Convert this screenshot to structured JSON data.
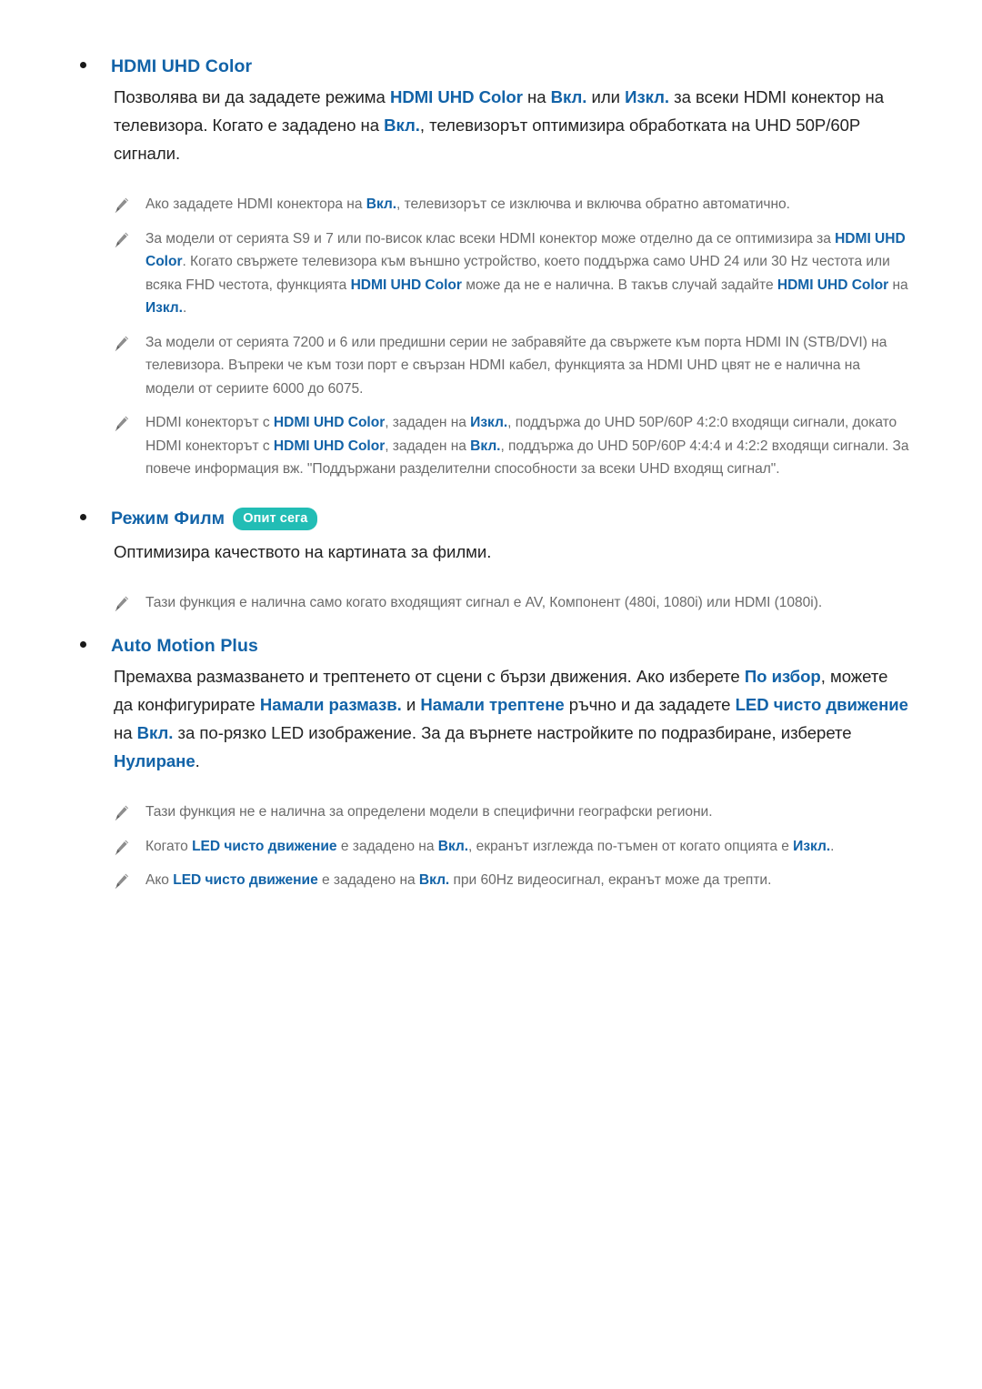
{
  "document": {
    "language": "bg",
    "colors": {
      "link_blue": "#1263a8",
      "body_text": "#232323",
      "note_text": "#6b6b6b",
      "badge_teal": "#22bdb5",
      "bullet": "#1a1a1a",
      "background": "#ffffff"
    }
  },
  "sections": [
    {
      "id": "hdmi-uhd-color",
      "title": "HDMI UHD Color",
      "badge": null,
      "paragraph_html": "Позволява ви да зададете режима <b>HDMI UHD Color</b> на <b>Вкл.</b> или <b>Изкл.</b> за всеки HDMI конектор на телевизора. Когато е зададено на <b>Вкл.</b>, телевизорът оптимизира обработката на UHD 50P/60P сигнали.",
      "notes": [
        "Ако зададете HDMI конектора на <b>Вкл.</b>, телевизорът се изключва и включва обратно автоматично.",
        "За модели от серията S9 и 7 или по-висок клас всеки HDMI конектор може отделно да се оптимизира за <b>HDMI UHD Color</b>. Когато свържете телевизора към външно устройство, което поддържа само UHD 24 или 30 Hz честота или всяка FHD честота, функцията <b>HDMI UHD Color</b> може да не е налична. В такъв случай задайте <b>HDMI UHD Color</b> на <b>Изкл.</b>.",
        "За модели от серията 7200 и 6 или предишни серии не забравяйте да свържете към порта HDMI IN (STB/DVI) на телевизора. Въпреки че към този порт е свързан HDMI кабел, функцията за HDMI UHD цвят не е налична на модели от сериите 6000 до 6075.",
        "HDMI конекторът с <b>HDMI UHD Color</b>, зададен на <b>Изкл.</b>, поддържа до UHD 50P/60P 4:2:0 входящи сигнали, докато HDMI конекторът с <b>HDMI UHD Color</b>, зададен на <b>Вкл.</b>, поддържа до UHD 50P/60P 4:4:4 и 4:2:2 входящи сигнали. За повече информация вж. \"Поддържани разделителни способности за всеки UHD входящ сигнал\"."
      ]
    },
    {
      "id": "rezhim-film",
      "title": "Режим Филм",
      "badge": "Опит сега",
      "paragraph_html": "Оптимизира качеството на картината за филми.",
      "notes": [
        "Тази функция е налична само когато входящият сигнал е AV, Компонент (480i, 1080i) или HDMI (1080i)."
      ]
    },
    {
      "id": "auto-motion-plus",
      "title": "Auto Motion Plus",
      "badge": null,
      "paragraph_html": "Премахва размазването и трептенето от сцени с бързи движения. Ако изберете <b>По избор</b>, можете да конфигурирате <b>Намали размазв.</b> и <b>Намали трептене</b> ръчно и да зададете <b>LED чисто движение</b> на <b>Вкл.</b> за по-рязко LED изображение. За да върнете настройките по подразбиране, изберете <b>Нулиране</b>.",
      "notes": [
        "Тази функция не е налична за определени модели в специфични географски региони.",
        "Когато <b>LED чисто движение</b> е зададено на <b>Вкл.</b>, екранът изглежда по-тъмен от когато опцията е <b>Изкл.</b>.",
        "Ако <b>LED чисто движение</b> е зададено на <b>Вкл.</b> при 60Hz видеосигнал, екранът може да трепти."
      ]
    }
  ],
  "icons": {
    "note": "pencil-icon",
    "bullet": "bullet-dot-icon"
  }
}
